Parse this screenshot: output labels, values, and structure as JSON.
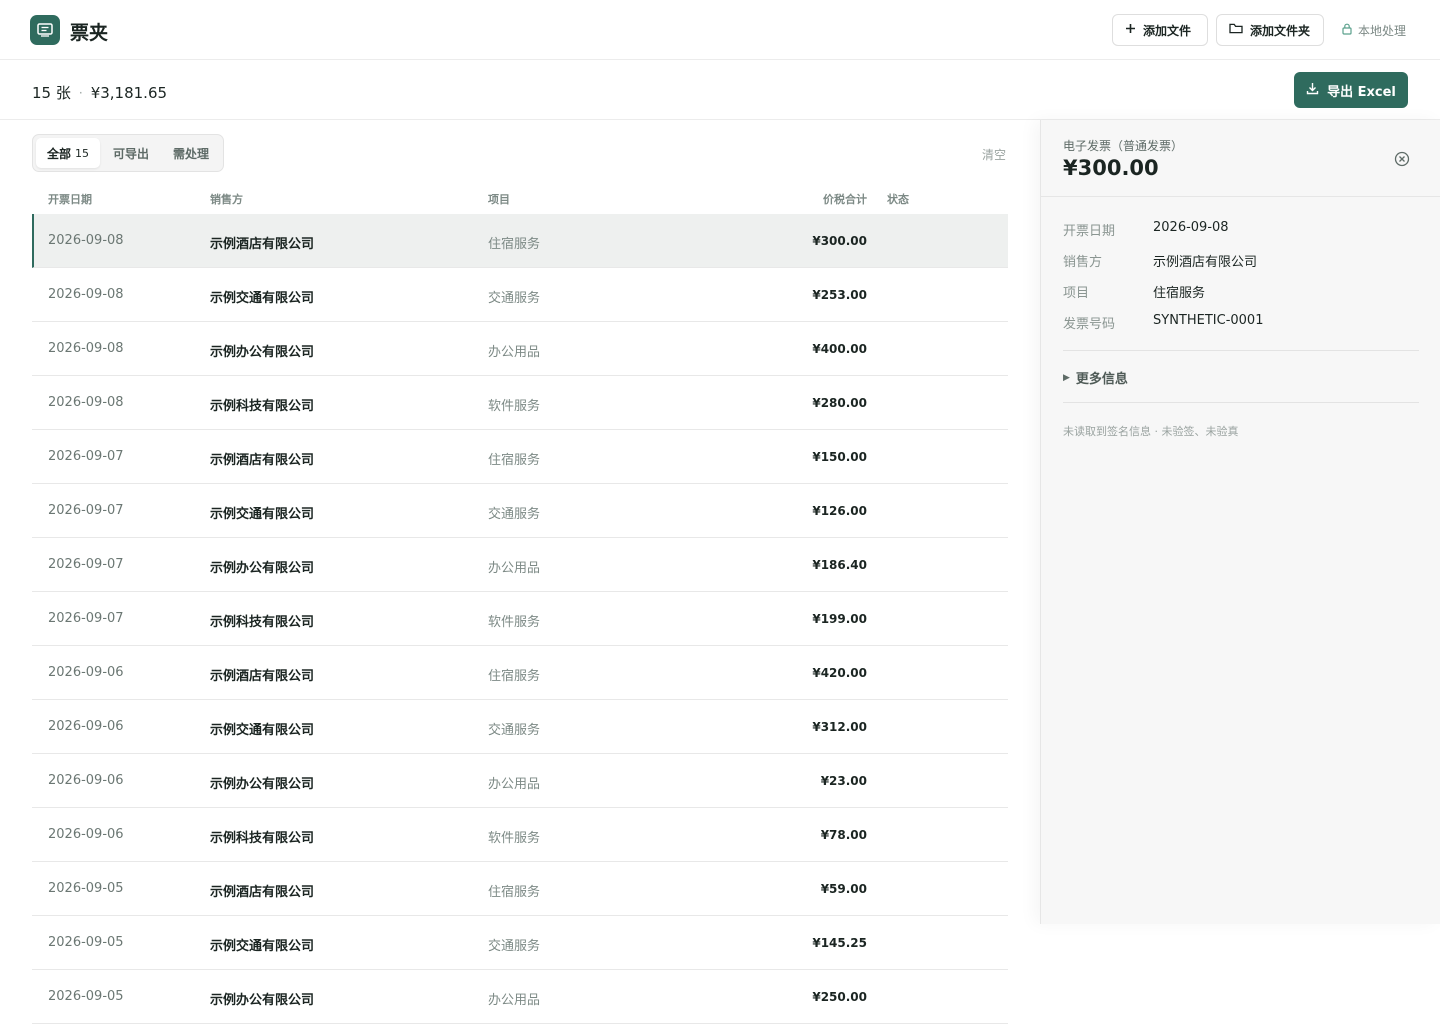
{
  "header": {
    "title": "票夹",
    "add_file_label": "添加文件",
    "add_folder_label": "添加文件夹",
    "local_label": "本地处理"
  },
  "summary": {
    "count_label": "15 张",
    "separator": "·",
    "total_label": "¥3,181.65",
    "export_label": "导出 Excel"
  },
  "filters": {
    "tabs": [
      {
        "label": "全部",
        "count": "15"
      },
      {
        "label": "可导出",
        "count": ""
      },
      {
        "label": "需处理",
        "count": ""
      }
    ],
    "clear_label": "清空"
  },
  "table": {
    "columns": {
      "date": "开票日期",
      "seller": "销售方",
      "item": "项目",
      "amount": "价税合计",
      "status": "状态"
    },
    "rows": [
      {
        "date": "2026-09-08",
        "seller": "示例酒店有限公司",
        "item": "住宿服务",
        "amount": "¥300.00",
        "status": ""
      },
      {
        "date": "2026-09-08",
        "seller": "示例交通有限公司",
        "item": "交通服务",
        "amount": "¥253.00",
        "status": ""
      },
      {
        "date": "2026-09-08",
        "seller": "示例办公有限公司",
        "item": "办公用品",
        "amount": "¥400.00",
        "status": ""
      },
      {
        "date": "2026-09-08",
        "seller": "示例科技有限公司",
        "item": "软件服务",
        "amount": "¥280.00",
        "status": ""
      },
      {
        "date": "2026-09-07",
        "seller": "示例酒店有限公司",
        "item": "住宿服务",
        "amount": "¥150.00",
        "status": ""
      },
      {
        "date": "2026-09-07",
        "seller": "示例交通有限公司",
        "item": "交通服务",
        "amount": "¥126.00",
        "status": ""
      },
      {
        "date": "2026-09-07",
        "seller": "示例办公有限公司",
        "item": "办公用品",
        "amount": "¥186.40",
        "status": ""
      },
      {
        "date": "2026-09-07",
        "seller": "示例科技有限公司",
        "item": "软件服务",
        "amount": "¥199.00",
        "status": ""
      },
      {
        "date": "2026-09-06",
        "seller": "示例酒店有限公司",
        "item": "住宿服务",
        "amount": "¥420.00",
        "status": ""
      },
      {
        "date": "2026-09-06",
        "seller": "示例交通有限公司",
        "item": "交通服务",
        "amount": "¥312.00",
        "status": ""
      },
      {
        "date": "2026-09-06",
        "seller": "示例办公有限公司",
        "item": "办公用品",
        "amount": "¥23.00",
        "status": ""
      },
      {
        "date": "2026-09-06",
        "seller": "示例科技有限公司",
        "item": "软件服务",
        "amount": "¥78.00",
        "status": ""
      },
      {
        "date": "2026-09-05",
        "seller": "示例酒店有限公司",
        "item": "住宿服务",
        "amount": "¥59.00",
        "status": ""
      },
      {
        "date": "2026-09-05",
        "seller": "示例交通有限公司",
        "item": "交通服务",
        "amount": "¥145.25",
        "status": ""
      },
      {
        "date": "2026-09-05",
        "seller": "示例办公有限公司",
        "item": "办公用品",
        "amount": "¥250.00",
        "status": ""
      }
    ]
  },
  "detail": {
    "type_label": "电子发票（普通发票）",
    "amount": "¥300.00",
    "fields": [
      {
        "label": "开票日期",
        "value": "2026-09-08"
      },
      {
        "label": "销售方",
        "value": "示例酒店有限公司"
      },
      {
        "label": "项目",
        "value": "住宿服务"
      },
      {
        "label": "发票号码",
        "value": "SYNTHETIC-0001"
      }
    ],
    "more_label": "更多信息",
    "note": "未读取到签名信息 · 未验签、未验真"
  },
  "colors": {
    "accent": "#2f6b5e",
    "selected_row": "#eef0ef",
    "panel_bg": "#f7f7f7"
  },
  "icons": [
    "app-logo-icon",
    "plus-icon",
    "folder-icon",
    "lock-icon",
    "download-icon",
    "close-circle-icon",
    "triangle-right-icon"
  ]
}
